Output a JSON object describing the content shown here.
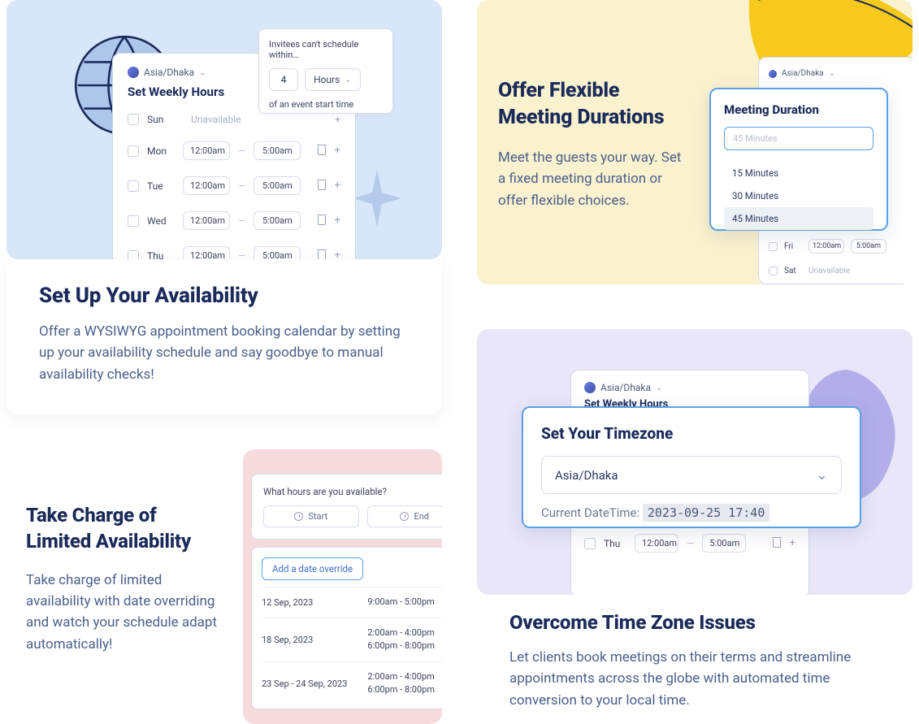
{
  "card1": {
    "timezone": "Asia/Dhaka",
    "panel_title": "Set Weekly Hours",
    "unavailable_label": "Unavailable",
    "days": [
      {
        "name": "Sun",
        "unavailable": true
      },
      {
        "name": "Mon",
        "start": "12:00am",
        "end": "5:00am"
      },
      {
        "name": "Tue",
        "start": "12:00am",
        "end": "5:00am"
      },
      {
        "name": "Wed",
        "start": "12:00am",
        "end": "5:00am"
      },
      {
        "name": "Thu",
        "start": "12:00am",
        "end": "5:00am"
      }
    ],
    "popover": {
      "label": "Invitees can't schedule within…",
      "value": "4",
      "unit": "Hours",
      "footer": "of an event start time"
    },
    "feat_title": "Set Up Your Availability",
    "feat_desc": "Offer a WYSIWYG appointment booking calendar by setting up your availability schedule and say goodbye to manual availability checks!"
  },
  "card2": {
    "feat_title": "Offer Flexible Meeting Durations",
    "feat_desc": "Meet the guests your way. Set a fixed meeting duration or offer flexible choices.",
    "timezone": "Asia/Dhaka",
    "days": [
      {
        "name": "Fri",
        "start": "12:00am",
        "end": "5:00am"
      },
      {
        "name": "Sat",
        "unavailable": true
      }
    ],
    "unavailable_label": "Unavailable",
    "popover": {
      "title": "Meeting Duration",
      "placeholder": "45 Minutes",
      "options": [
        "15 Minutes",
        "30 Minutes",
        "45 Minutes"
      ],
      "selected": "45 Minutes"
    }
  },
  "card3": {
    "feat_title": "Take Charge of Limited Availability",
    "feat_desc": "Take charge of limited availability with date overriding and watch your schedule adapt automatically!",
    "panel1": {
      "label": "What hours are you available?",
      "start": "Start",
      "end": "End"
    },
    "panel2": {
      "button": "Add a date override",
      "overrides": [
        {
          "date": "12 Sep, 2023",
          "time1": "9:00am - 5:00pm"
        },
        {
          "date": "18 Sep, 2023",
          "time1": "2:00am - 4:00pm",
          "time2": "6:00pm - 8:00pm"
        },
        {
          "date": "23 Sep - 24 Sep, 2023",
          "time1": "2:00am - 4:00pm",
          "time2": "6:00pm - 8:00pm"
        }
      ]
    }
  },
  "card4": {
    "timezone": "Asia/Dhaka",
    "panel_title": "Set Weekly Hours",
    "days": [
      {
        "name": "Thu",
        "start": "12:00am",
        "end": "5:00am"
      }
    ],
    "popover": {
      "title": "Set Your Timezone",
      "value": "Asia/Dhaka",
      "dt_label": "Current DateTime: ",
      "dt_value": "2023-09-25 17:40"
    },
    "feat_title": "Overcome Time Zone Issues",
    "feat_desc": "Let clients book meetings on their terms and streamline appointments across the globe with automated time conversion to your local time."
  }
}
